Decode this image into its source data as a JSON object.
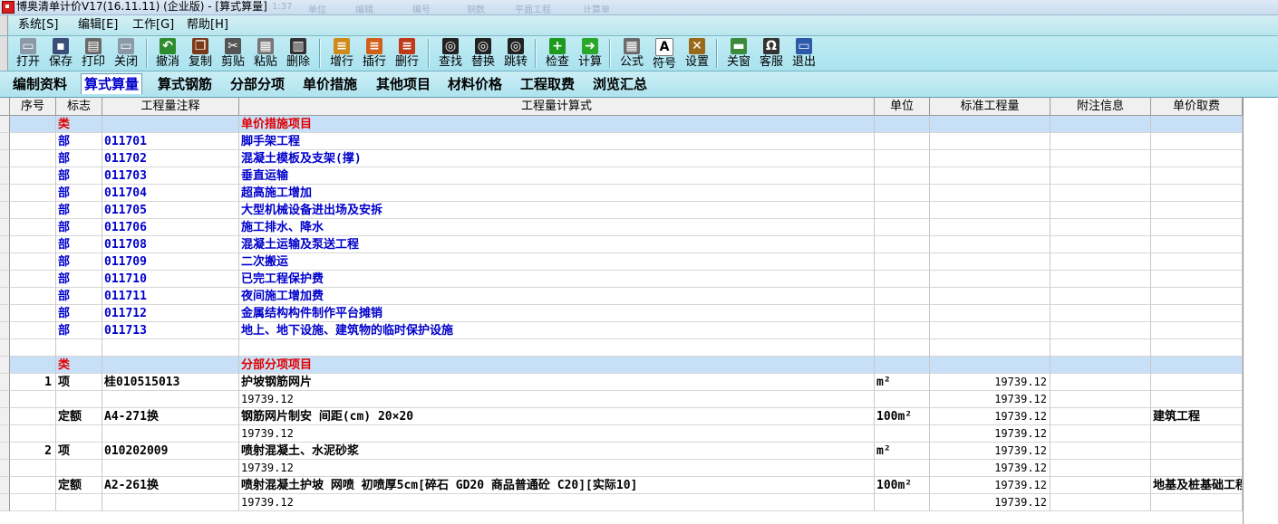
{
  "window": {
    "title": "博奥清单计价V17(16.11.11) (企业版) - [算式算量]",
    "ghost_labels": [
      "1:37",
      "单位",
      "编辑",
      "编号",
      "铜数",
      "平面工程",
      "计算单"
    ]
  },
  "menu": [
    "系统[S]",
    "编辑[E]",
    "工作[G]",
    "帮助[H]"
  ],
  "toolbar": [
    {
      "label": "打开",
      "icon": "open-folder-icon",
      "color": "#8a9aa8",
      "glyph": "▭"
    },
    {
      "label": "保存",
      "icon": "floppy-disk-icon",
      "color": "#3a4e78",
      "glyph": "▪"
    },
    {
      "label": "打印",
      "icon": "printer-icon",
      "color": "#6a6a6a",
      "glyph": "▤"
    },
    {
      "label": "关闭",
      "icon": "close-folder-icon",
      "color": "#8a9aa8",
      "glyph": "▭"
    },
    {
      "label": "撤消",
      "icon": "undo-arrow-icon",
      "color": "#2e8b2e",
      "glyph": "↶"
    },
    {
      "label": "复制",
      "icon": "copy-book-icon",
      "color": "#7a3a1a",
      "glyph": "❐"
    },
    {
      "label": "剪贴",
      "icon": "scissors-icon",
      "color": "#555555",
      "glyph": "✂"
    },
    {
      "label": "粘贴",
      "icon": "paste-keyboard-icon",
      "color": "#777777",
      "glyph": "▦"
    },
    {
      "label": "删除",
      "icon": "trash-bin-icon",
      "color": "#333333",
      "glyph": "▥"
    },
    {
      "label": "增行",
      "icon": "insert-row-icon",
      "color": "#d08a1a",
      "glyph": "≡"
    },
    {
      "label": "插行",
      "icon": "insert-line-icon",
      "color": "#d0601a",
      "glyph": "≡"
    },
    {
      "label": "删行",
      "icon": "delete-row-icon",
      "color": "#c03a1a",
      "glyph": "≡"
    },
    {
      "label": "查找",
      "icon": "binoculars-icon",
      "color": "#222222",
      "glyph": "◎"
    },
    {
      "label": "替换",
      "icon": "replace-binoculars-icon",
      "color": "#222222",
      "glyph": "◎"
    },
    {
      "label": "跳转",
      "icon": "jump-binoculars-icon",
      "color": "#222222",
      "glyph": "◎"
    },
    {
      "label": "检查",
      "icon": "check-plus-icon",
      "color": "#1f9a1f",
      "glyph": "+"
    },
    {
      "label": "计算",
      "icon": "calc-arrow-icon",
      "color": "#2aa82a",
      "glyph": "➜"
    },
    {
      "label": "公式",
      "icon": "calculator-icon",
      "color": "#6b6b6b",
      "glyph": "▦"
    },
    {
      "label": "符号",
      "icon": "symbol-a-icon",
      "color": "#ffffff",
      "glyph": "A"
    },
    {
      "label": "设置",
      "icon": "tools-icon",
      "color": "#9a6a1a",
      "glyph": "✕"
    },
    {
      "label": "关窗",
      "icon": "close-window-icon",
      "color": "#3a8a3a",
      "glyph": "▬"
    },
    {
      "label": "客服",
      "icon": "headset-icon",
      "color": "#333333",
      "glyph": "Ω"
    },
    {
      "label": "退出",
      "icon": "exit-monitor-icon",
      "color": "#2a5aa8",
      "glyph": "▭"
    }
  ],
  "tabs": [
    "编制资料",
    "算式算量",
    "算式钢筋",
    "分部分项",
    "单价措施",
    "其他项目",
    "材料价格",
    "工程取费",
    "浏览汇总"
  ],
  "active_tab": "算式算量",
  "grid": {
    "headers": [
      "序号",
      "标志",
      "工程量注释",
      "工程量计算式",
      "单位",
      "标准工程量",
      "附注信息",
      "单价取费"
    ],
    "rows": [
      {
        "no": "",
        "flag": "类",
        "note": "",
        "expr": "单价措施项目",
        "unit": "",
        "qty": "",
        "remark": "",
        "fee": "",
        "kind": "cat"
      },
      {
        "no": "",
        "flag": "部",
        "note": "011701",
        "expr": "脚手架工程",
        "unit": "",
        "qty": "",
        "remark": "",
        "fee": "",
        "kind": "part"
      },
      {
        "no": "",
        "flag": "部",
        "note": "011702",
        "expr": "混凝土模板及支架(撑)",
        "unit": "",
        "qty": "",
        "remark": "",
        "fee": "",
        "kind": "part"
      },
      {
        "no": "",
        "flag": "部",
        "note": "011703",
        "expr": "垂直运输",
        "unit": "",
        "qty": "",
        "remark": "",
        "fee": "",
        "kind": "part"
      },
      {
        "no": "",
        "flag": "部",
        "note": "011704",
        "expr": "超高施工增加",
        "unit": "",
        "qty": "",
        "remark": "",
        "fee": "",
        "kind": "part"
      },
      {
        "no": "",
        "flag": "部",
        "note": "011705",
        "expr": "大型机械设备进出场及安拆",
        "unit": "",
        "qty": "",
        "remark": "",
        "fee": "",
        "kind": "part"
      },
      {
        "no": "",
        "flag": "部",
        "note": "011706",
        "expr": "施工排水、降水",
        "unit": "",
        "qty": "",
        "remark": "",
        "fee": "",
        "kind": "part"
      },
      {
        "no": "",
        "flag": "部",
        "note": "011708",
        "expr": "混凝土运输及泵送工程",
        "unit": "",
        "qty": "",
        "remark": "",
        "fee": "",
        "kind": "part"
      },
      {
        "no": "",
        "flag": "部",
        "note": "011709",
        "expr": "二次搬运",
        "unit": "",
        "qty": "",
        "remark": "",
        "fee": "",
        "kind": "part"
      },
      {
        "no": "",
        "flag": "部",
        "note": "011710",
        "expr": "已完工程保护费",
        "unit": "",
        "qty": "",
        "remark": "",
        "fee": "",
        "kind": "part"
      },
      {
        "no": "",
        "flag": "部",
        "note": "011711",
        "expr": "夜间施工增加费",
        "unit": "",
        "qty": "",
        "remark": "",
        "fee": "",
        "kind": "part"
      },
      {
        "no": "",
        "flag": "部",
        "note": "011712",
        "expr": "金属结构构件制作平台摊销",
        "unit": "",
        "qty": "",
        "remark": "",
        "fee": "",
        "kind": "part"
      },
      {
        "no": "",
        "flag": "部",
        "note": "011713",
        "expr": "地上、地下设施、建筑物的临时保护设施",
        "unit": "",
        "qty": "",
        "remark": "",
        "fee": "",
        "kind": "part"
      },
      {
        "no": "",
        "flag": "",
        "note": "",
        "expr": "",
        "unit": "",
        "qty": "",
        "remark": "",
        "fee": "",
        "kind": "blank"
      },
      {
        "no": "",
        "flag": "类",
        "note": "",
        "expr": "分部分项项目",
        "unit": "",
        "qty": "",
        "remark": "",
        "fee": "",
        "kind": "cat"
      },
      {
        "no": "1",
        "flag": "项",
        "note": "桂010515013",
        "expr": "护坡钢筋网片",
        "unit": "m²",
        "qty": "19739.12",
        "remark": "",
        "fee": "",
        "kind": "item"
      },
      {
        "no": "",
        "flag": "",
        "note": "",
        "expr": "19739.12",
        "unit": "",
        "qty": "19739.12",
        "remark": "",
        "fee": "",
        "kind": "calc"
      },
      {
        "no": "",
        "flag": "定额",
        "note": "A4-271换",
        "expr": "钢筋网片制安 间距(cm) 20×20",
        "unit": "100m²",
        "qty": "19739.12",
        "remark": "",
        "fee": "建筑工程",
        "kind": "item"
      },
      {
        "no": "",
        "flag": "",
        "note": "",
        "expr": "19739.12",
        "unit": "",
        "qty": "19739.12",
        "remark": "",
        "fee": "",
        "kind": "calc"
      },
      {
        "no": "2",
        "flag": "项",
        "note": "010202009",
        "expr": "喷射混凝土、水泥砂浆",
        "unit": "m²",
        "qty": "19739.12",
        "remark": "",
        "fee": "",
        "kind": "item"
      },
      {
        "no": "",
        "flag": "",
        "note": "",
        "expr": "19739.12",
        "unit": "",
        "qty": "19739.12",
        "remark": "",
        "fee": "",
        "kind": "calc"
      },
      {
        "no": "",
        "flag": "定额",
        "note": "A2-261换",
        "expr": "喷射混凝土护坡 网喷 初喷厚5cm[碎石 GD20  商品普通砼  C20][实际10]",
        "unit": "100m²",
        "qty": "19739.12",
        "remark": "",
        "fee": "地基及桩基础工程",
        "kind": "item"
      },
      {
        "no": "",
        "flag": "",
        "note": "",
        "expr": "19739.12",
        "unit": "",
        "qty": "19739.12",
        "remark": "",
        "fee": "",
        "kind": "calc"
      }
    ]
  }
}
